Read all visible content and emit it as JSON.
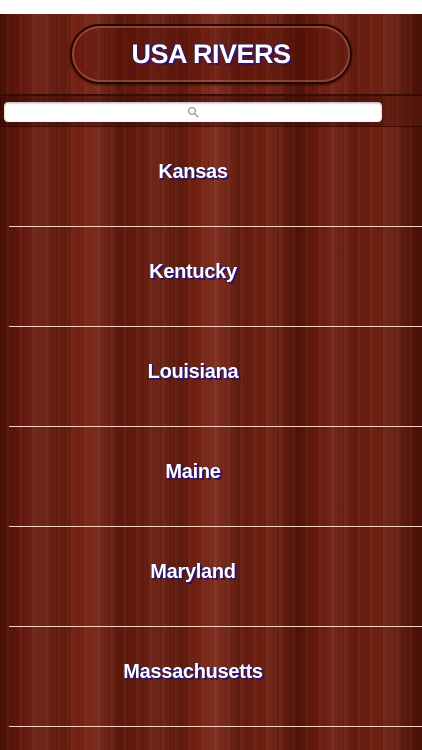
{
  "header": {
    "title": "USA RIVERS"
  },
  "search": {
    "placeholder": "",
    "value": ""
  },
  "list": {
    "items": [
      {
        "label": "Kansas"
      },
      {
        "label": "Kentucky"
      },
      {
        "label": "Louisiana"
      },
      {
        "label": "Maine"
      },
      {
        "label": "Maryland"
      },
      {
        "label": "Massachusetts"
      }
    ]
  },
  "icons": {
    "search": "search-icon"
  },
  "colors": {
    "wood": "#6a1a0e",
    "text_shadow": "#2a1670",
    "divider": "#e8d8d2"
  }
}
